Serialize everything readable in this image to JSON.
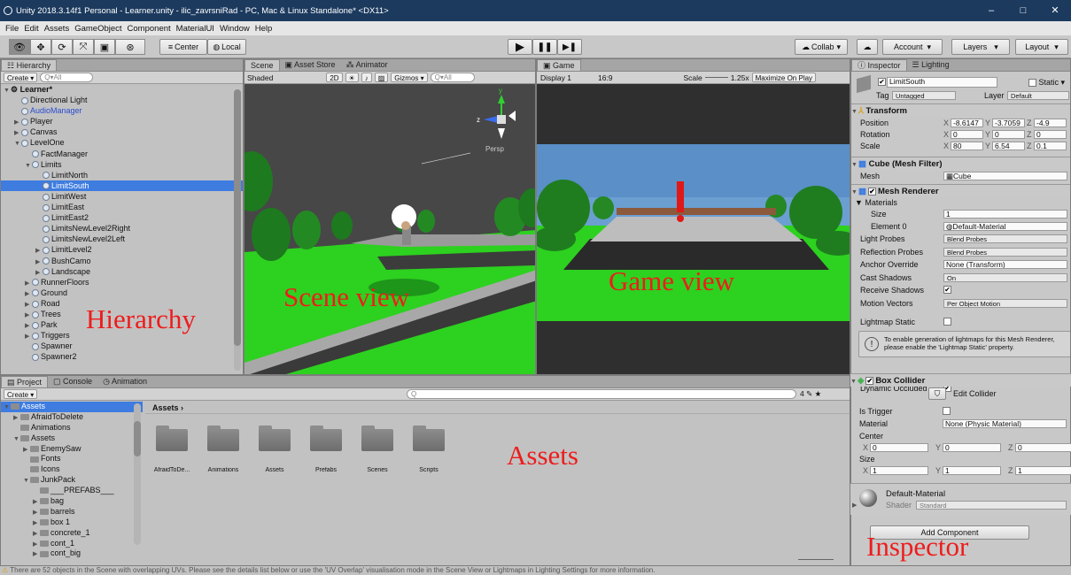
{
  "window": {
    "title": "Unity 2018.3.14f1 Personal - Learner.unity - ilic_zavrsniRad - PC, Mac & Linux Standalone* <DX11>",
    "minimize": "–",
    "maximize": "□",
    "close": "✕"
  },
  "menu": [
    "File",
    "Edit",
    "Assets",
    "GameObject",
    "Component",
    "MaterialUI",
    "Window",
    "Help"
  ],
  "toolbar": {
    "center": "Center",
    "local": "Local",
    "collab": "Collab",
    "account": "Account",
    "layers": "Layers",
    "layout": "Layout"
  },
  "hierarchy": {
    "tab": "Hierarchy",
    "create": "Create",
    "search_placeholder": "All",
    "scene": "Learner*",
    "items": [
      {
        "label": "Directional Light",
        "indent": 1,
        "arrow": false,
        "blue": false,
        "selected": false
      },
      {
        "label": "AudioManager",
        "indent": 1,
        "arrow": false,
        "blue": true,
        "selected": false
      },
      {
        "label": "Player",
        "indent": 1,
        "arrow": true,
        "open": false,
        "blue": false,
        "selected": false
      },
      {
        "label": "Canvas",
        "indent": 1,
        "arrow": true,
        "open": false,
        "blue": false,
        "selected": false
      },
      {
        "label": "LevelOne",
        "indent": 1,
        "arrow": true,
        "open": true,
        "blue": false,
        "selected": false
      },
      {
        "label": "FactManager",
        "indent": 2,
        "arrow": false,
        "blue": false,
        "selected": false
      },
      {
        "label": "Limits",
        "indent": 2,
        "arrow": true,
        "open": true,
        "blue": false,
        "selected": false
      },
      {
        "label": "LimitNorth",
        "indent": 3,
        "arrow": false,
        "blue": false,
        "selected": false
      },
      {
        "label": "LimitSouth",
        "indent": 3,
        "arrow": false,
        "blue": false,
        "selected": true
      },
      {
        "label": "LimitWest",
        "indent": 3,
        "arrow": false,
        "blue": false,
        "selected": false
      },
      {
        "label": "LimitEast",
        "indent": 3,
        "arrow": false,
        "blue": false,
        "selected": false
      },
      {
        "label": "LimitEast2",
        "indent": 3,
        "arrow": false,
        "blue": false,
        "selected": false
      },
      {
        "label": "LimitsNewLevel2Right",
        "indent": 3,
        "arrow": false,
        "blue": false,
        "selected": false
      },
      {
        "label": "LimitsNewLevel2Left",
        "indent": 3,
        "arrow": false,
        "blue": false,
        "selected": false
      },
      {
        "label": "LimitLevel2",
        "indent": 3,
        "arrow": true,
        "open": false,
        "blue": false,
        "selected": false
      },
      {
        "label": "BushCamo",
        "indent": 3,
        "arrow": true,
        "open": false,
        "blue": false,
        "selected": false
      },
      {
        "label": "Landscape",
        "indent": 3,
        "arrow": true,
        "open": false,
        "blue": false,
        "selected": false
      },
      {
        "label": "RunnerFloors",
        "indent": 2,
        "arrow": true,
        "open": false,
        "blue": false,
        "selected": false
      },
      {
        "label": "Ground",
        "indent": 2,
        "arrow": true,
        "open": false,
        "blue": false,
        "selected": false
      },
      {
        "label": "Road",
        "indent": 2,
        "arrow": true,
        "open": false,
        "blue": false,
        "selected": false
      },
      {
        "label": "Trees",
        "indent": 2,
        "arrow": true,
        "open": false,
        "blue": false,
        "selected": false
      },
      {
        "label": "Park",
        "indent": 2,
        "arrow": true,
        "open": false,
        "blue": false,
        "selected": false
      },
      {
        "label": "Triggers",
        "indent": 2,
        "arrow": true,
        "open": false,
        "blue": false,
        "selected": false
      },
      {
        "label": "Spawner",
        "indent": 2,
        "arrow": false,
        "blue": false,
        "selected": false
      },
      {
        "label": "Spawner2",
        "indent": 2,
        "arrow": false,
        "blue": false,
        "selected": false
      }
    ]
  },
  "scene": {
    "tabs": [
      "Scene",
      "Asset Store",
      "Animator"
    ],
    "shaded": "Shaded",
    "mode2d": "2D",
    "gizmos": "Gizmos",
    "search_placeholder": "All",
    "persp": "Persp",
    "axis_y": "y",
    "axis_z": "z"
  },
  "game": {
    "tab": "Game",
    "display": "Display 1",
    "aspect": "16:9",
    "scale_label": "Scale",
    "scale_value": "1.25x",
    "maximize": "Maximize On Play"
  },
  "inspector": {
    "tabs": [
      "Inspector",
      "Lighting"
    ],
    "object_name": "LimitSouth",
    "static_label": "Static",
    "tag_label": "Tag",
    "tag_value": "Untagged",
    "layer_label": "Layer",
    "layer_value": "Default",
    "transform": {
      "title": "Transform",
      "position": {
        "label": "Position",
        "x": "-8.6147",
        "y": "-3.7059",
        "z": "-4.9"
      },
      "rotation": {
        "label": "Rotation",
        "x": "0",
        "y": "0",
        "z": "0"
      },
      "scale": {
        "label": "Scale",
        "x": "80",
        "y": "6.54",
        "z": "0.1"
      }
    },
    "mesh_filter": {
      "title": "Cube (Mesh Filter)",
      "mesh_label": "Mesh",
      "mesh_value": "Cube"
    },
    "mesh_renderer": {
      "title": "Mesh Renderer",
      "materials": "Materials",
      "size_label": "Size",
      "size_value": "1",
      "element_label": "Element 0",
      "element_value": "Default-Material",
      "rows": [
        {
          "label": "Light Probes",
          "value": "Blend Probes"
        },
        {
          "label": "Reflection Probes",
          "value": "Blend Probes"
        },
        {
          "label": "Anchor Override",
          "value": "None (Transform)"
        },
        {
          "label": "Cast Shadows",
          "value": "On"
        },
        {
          "label": "Receive Shadows",
          "value": "✔"
        },
        {
          "label": "Motion Vectors",
          "value": "Per Object Motion"
        }
      ],
      "lightmap_static": "Lightmap Static",
      "info": "To enable generation of lightmaps for this Mesh Renderer, please enable the 'Lightmap Static' property.",
      "dynamic_occluded": "Dynamic Occluded"
    },
    "box_collider": {
      "title": "Box Collider",
      "edit": "Edit Collider",
      "is_trigger": "Is Trigger",
      "material_label": "Material",
      "material_value": "None (Physic Material)",
      "center_label": "Center",
      "center": {
        "x": "0",
        "y": "0",
        "z": "0"
      },
      "size_label": "Size",
      "size": {
        "x": "1",
        "y": "1",
        "z": "1"
      }
    },
    "material": {
      "name": "Default-Material",
      "shader_label": "Shader",
      "shader_value": "Standard"
    },
    "add_component": "Add Component"
  },
  "project": {
    "tabs": [
      "Project",
      "Console",
      "Animation"
    ],
    "create": "Create",
    "breadcrumb": "Assets",
    "counter": "4",
    "tree": [
      {
        "label": "Assets",
        "indent": 0,
        "arrow": true,
        "selected": true
      },
      {
        "label": "AfraidToDelete",
        "indent": 1,
        "arrow": true,
        "selected": false
      },
      {
        "label": "Animations",
        "indent": 1,
        "arrow": false,
        "selected": false
      },
      {
        "label": "Assets",
        "indent": 1,
        "arrow": true,
        "selected": false
      },
      {
        "label": "EnemySaw",
        "indent": 2,
        "arrow": true,
        "selected": false
      },
      {
        "label": "Fonts",
        "indent": 2,
        "arrow": false,
        "selected": false
      },
      {
        "label": "Icons",
        "indent": 2,
        "arrow": false,
        "selected": false
      },
      {
        "label": "JunkPack",
        "indent": 2,
        "arrow": true,
        "selected": false
      },
      {
        "label": "___PREFABS___",
        "indent": 3,
        "arrow": false,
        "selected": false
      },
      {
        "label": "bag",
        "indent": 3,
        "arrow": true,
        "selected": false
      },
      {
        "label": "barrels",
        "indent": 3,
        "arrow": true,
        "selected": false
      },
      {
        "label": "box 1",
        "indent": 3,
        "arrow": true,
        "selected": false
      },
      {
        "label": "concrete_1",
        "indent": 3,
        "arrow": true,
        "selected": false
      },
      {
        "label": "cont_1",
        "indent": 3,
        "arrow": true,
        "selected": false
      },
      {
        "label": "cont_big",
        "indent": 3,
        "arrow": true,
        "selected": false
      }
    ],
    "folders": [
      "AfraidToDe...",
      "Animations",
      "Assets",
      "Prefabs",
      "Scenes",
      "Scripts"
    ]
  },
  "annotations": {
    "hierarchy": "Hierarchy",
    "scene": "Scene view",
    "game": "Game view",
    "assets": "Assets",
    "inspector": "Inspector"
  },
  "status": "There are 52 objects in the Scene with overlapping UVs. Please see the details list below or use the 'UV Overlap' visualisation mode in the Scene View or Lightmaps in Lighting Settings for more information."
}
